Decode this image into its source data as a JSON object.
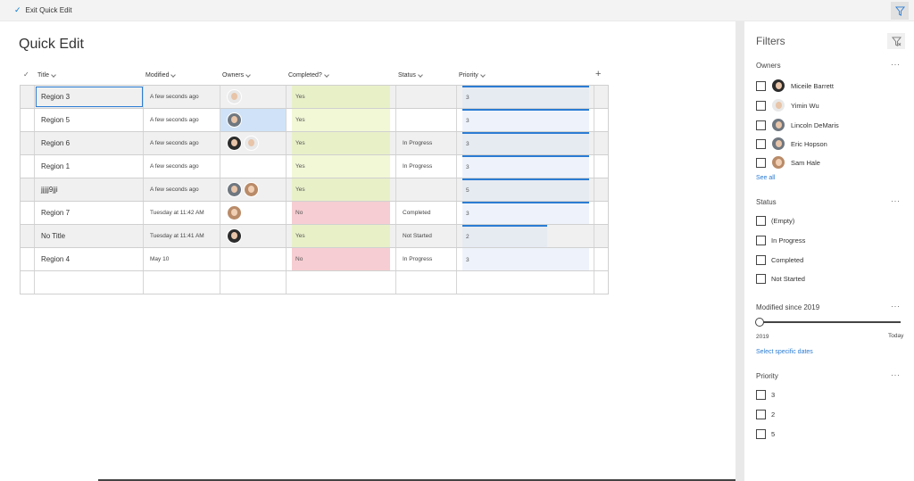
{
  "topbar": {
    "exit_label": "Exit Quick Edit",
    "filter_icon": "filter-icon"
  },
  "page_title": "Quick Edit",
  "columns": {
    "title": "Title",
    "modified": "Modified",
    "owners": "Owners",
    "completed": "Completed?",
    "status": "Status",
    "priority": "Priority"
  },
  "rows": [
    {
      "title": "Region 3",
      "modified": "A few seconds ago",
      "completed": "Yes",
      "status": "",
      "priority": "3",
      "priority_fill": 1.0
    },
    {
      "title": "Region 5",
      "modified": "A few seconds ago",
      "completed": "Yes",
      "status": "",
      "priority": "3",
      "priority_fill": 1.0
    },
    {
      "title": "Region 6",
      "modified": "A few seconds ago",
      "completed": "Yes",
      "status": "In Progress",
      "priority": "3",
      "priority_fill": 1.0
    },
    {
      "title": "Region 1",
      "modified": "A few seconds ago",
      "completed": "Yes",
      "status": "In Progress",
      "priority": "3",
      "priority_fill": 1.0
    },
    {
      "title": "jjjjj9jji",
      "modified": "A few seconds ago",
      "completed": "Yes",
      "status": "",
      "priority": "5",
      "priority_fill": 1.0
    },
    {
      "title": "Region 7",
      "modified": "Tuesday at 11:42 AM",
      "completed": "No",
      "status": "Completed",
      "priority": "3",
      "priority_fill": 1.0
    },
    {
      "title": "No Title",
      "modified": "Tuesday at 11:41 AM",
      "completed": "Yes",
      "status": "Not Started",
      "priority": "2",
      "priority_fill": 0.67
    },
    {
      "title": "Region 4",
      "modified": "May 10",
      "completed": "No",
      "status": "In Progress",
      "priority": "3",
      "priority_fill": 1.0
    }
  ],
  "filters": {
    "title": "Filters",
    "owners": {
      "title": "Owners",
      "items": [
        "Miceile Barrett",
        "Yimin Wu",
        "Lincoln DeMaris",
        "Eric Hopson",
        "Sam Hale"
      ],
      "see_all": "See all"
    },
    "status": {
      "title": "Status",
      "items": [
        "(Empty)",
        "In Progress",
        "Completed",
        "Not Started"
      ]
    },
    "modified": {
      "title": "Modified since 2019",
      "from": "2019",
      "to": "Today",
      "link": "Select specific dates"
    },
    "priority": {
      "title": "Priority",
      "items": [
        "3",
        "2",
        "5"
      ]
    }
  },
  "colors": {
    "accent": "#2b7cd3",
    "yes": "#e8f0c8",
    "no": "#f6cdd2"
  }
}
